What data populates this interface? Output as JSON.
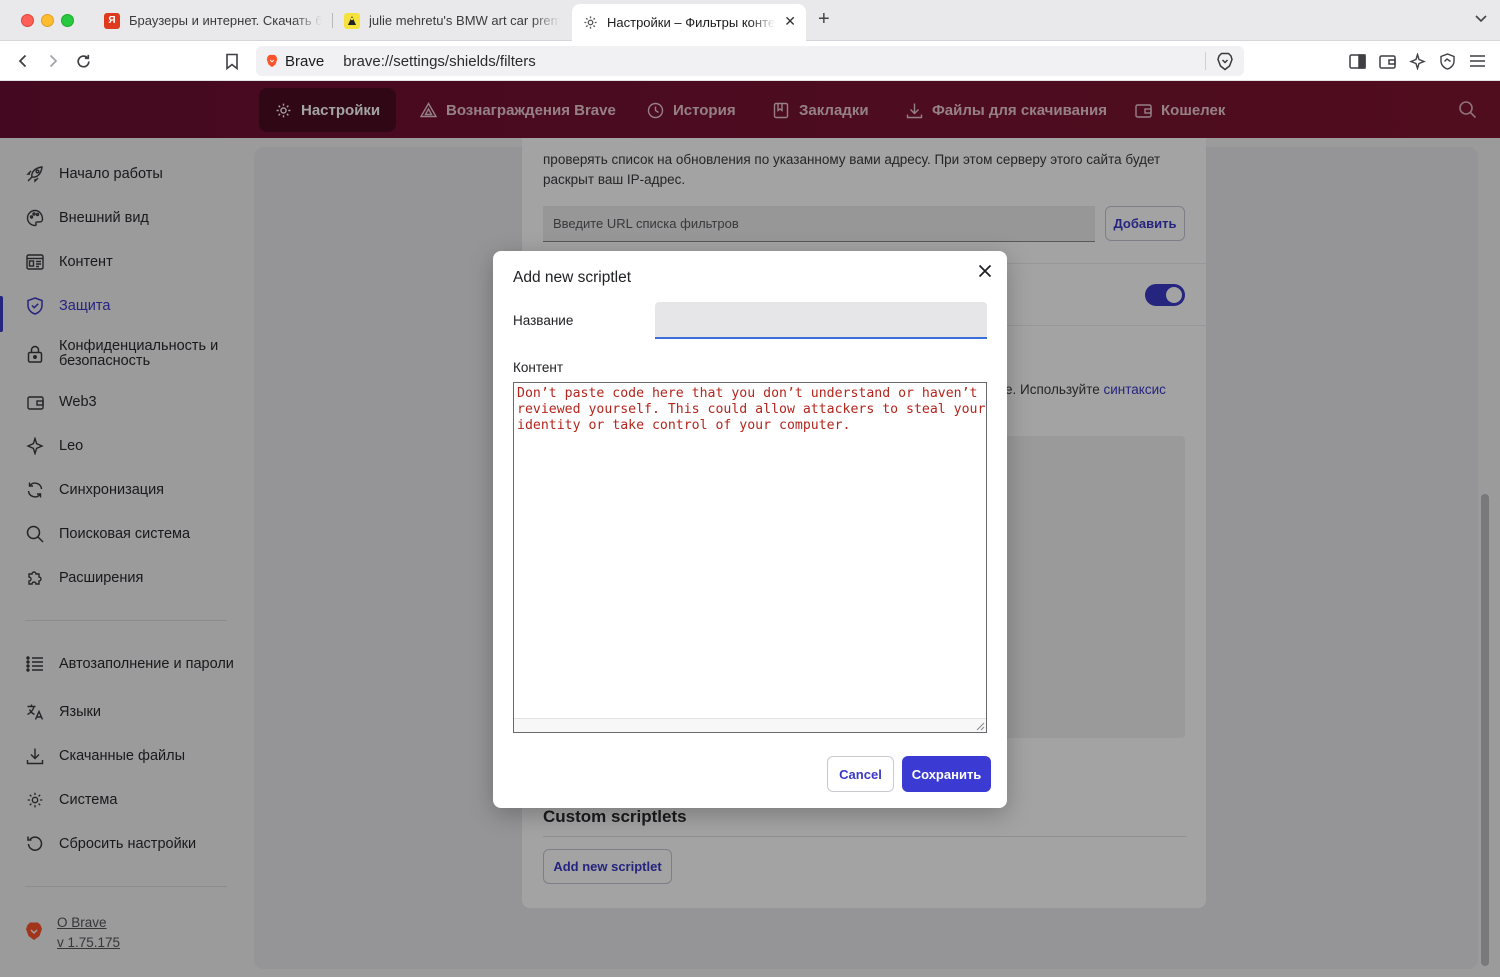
{
  "tabs": [
    {
      "title": "Браузеры и интернет. Скачать бесплатные",
      "favicon": "red-square-icon",
      "active": false
    },
    {
      "title": "julie mehretu's BMW art car premieres",
      "favicon": "yellow-logo-icon",
      "active": false
    },
    {
      "title": "Настройки – Фильтры контента",
      "favicon": "gear-icon",
      "active": true
    }
  ],
  "omnibox": {
    "brand": "Brave",
    "url": "brave://settings/shields/filters"
  },
  "topnav": [
    {
      "label": "Настройки",
      "icon": "gear-icon",
      "active": true
    },
    {
      "label": "Вознаграждения Brave",
      "icon": "triangle-icon",
      "active": false
    },
    {
      "label": "История",
      "icon": "history-icon",
      "active": false
    },
    {
      "label": "Закладки",
      "icon": "bookmarks-icon",
      "active": false
    },
    {
      "label": "Файлы для скачивания",
      "icon": "download-icon",
      "active": false
    },
    {
      "label": "Кошелек",
      "icon": "wallet-icon",
      "active": false
    }
  ],
  "sidebar": {
    "items": [
      {
        "label": "Начало работы",
        "icon": "rocket-icon"
      },
      {
        "label": "Внешний вид",
        "icon": "palette-icon"
      },
      {
        "label": "Контент",
        "icon": "content-icon"
      },
      {
        "label": "Защита",
        "icon": "shield-icon",
        "active": true
      },
      {
        "label": "Конфиденциальность и безопасность",
        "icon": "lock-icon"
      },
      {
        "label": "Web3",
        "icon": "wallet-icon"
      },
      {
        "label": "Leo",
        "icon": "sparkle-icon"
      },
      {
        "label": "Синхронизация",
        "icon": "sync-icon"
      },
      {
        "label": "Поисковая система",
        "icon": "search-icon"
      },
      {
        "label": "Расширения",
        "icon": "puzzle-icon"
      },
      {
        "label": "Автозаполнение и пароли",
        "icon": "list-icon"
      },
      {
        "label": "Языки",
        "icon": "translate-icon"
      },
      {
        "label": "Скачанные файлы",
        "icon": "download-icon"
      },
      {
        "label": "Система",
        "icon": "gear-icon"
      },
      {
        "label": "Сбросить настройки",
        "icon": "reset-icon"
      }
    ],
    "about": {
      "label": "О Brave",
      "version": "v 1.75.175"
    }
  },
  "main": {
    "filter_list_text": "проверять список на обновления по указанному вами адресу. При этом серверу этого сайта будет раскрыт ваш IP-адрес.",
    "filter_url_placeholder": "Введите URL списка фильтров",
    "add_button": "Добавить",
    "custom_filters_text_tail": "e. Используйте ",
    "custom_filters_link": "синтаксис",
    "toggle_on": true,
    "custom_scriptlets_title": "Custom scriptlets",
    "add_scriptlet_button": "Add new scriptlet"
  },
  "dialog": {
    "title": "Add new scriptlet",
    "name_label": "Название",
    "name_value": "",
    "content_label": "Контент",
    "content_value": "Don’t paste code here that you don’t understand or haven’t reviewed yourself. This could allow attackers to steal your identity or take control of your computer.",
    "cancel_label": "Cancel",
    "save_label": "Сохранить"
  },
  "colors": {
    "accent": "#3a39c6",
    "navbar": "#6b0f32",
    "warning_text": "#b3261e"
  }
}
